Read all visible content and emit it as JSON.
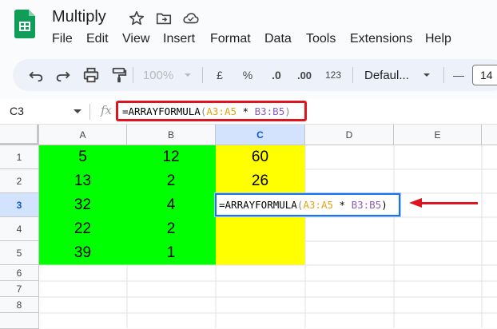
{
  "app": {
    "title": "Multiply"
  },
  "menu": [
    "File",
    "Edit",
    "View",
    "Insert",
    "Format",
    "Data",
    "Tools",
    "Extensions",
    "Help"
  ],
  "toolbar": {
    "zoom": "100%",
    "currency": "£",
    "percent": "%",
    "dec_decrease": ".0",
    "dec_increase": ".00",
    "number_format": "123",
    "font": "Defaul...",
    "font_size": "14",
    "minus": "—"
  },
  "formula_bar": {
    "cell_ref": "C3",
    "fx": "fx",
    "formula": {
      "fn": "=ARRAYFORMULA",
      "open": "(",
      "range1": "A3:A5",
      "op": " * ",
      "range2": "B3:B5",
      "close": ")"
    }
  },
  "columns": [
    "A",
    "B",
    "C",
    "D",
    "E"
  ],
  "rows": [
    "1",
    "2",
    "3",
    "4",
    "5",
    "6",
    "7",
    "8"
  ],
  "cells": {
    "A": [
      "5",
      "13",
      "32",
      "22",
      "39"
    ],
    "B": [
      "12",
      "2",
      "4",
      "2",
      "1"
    ],
    "C": [
      "60",
      "26"
    ]
  },
  "colors": {
    "green_fill": "#00ff00",
    "yellow_fill": "#ffff00",
    "highlight_red": "#e0141e",
    "selection_blue": "#1a73e8"
  }
}
